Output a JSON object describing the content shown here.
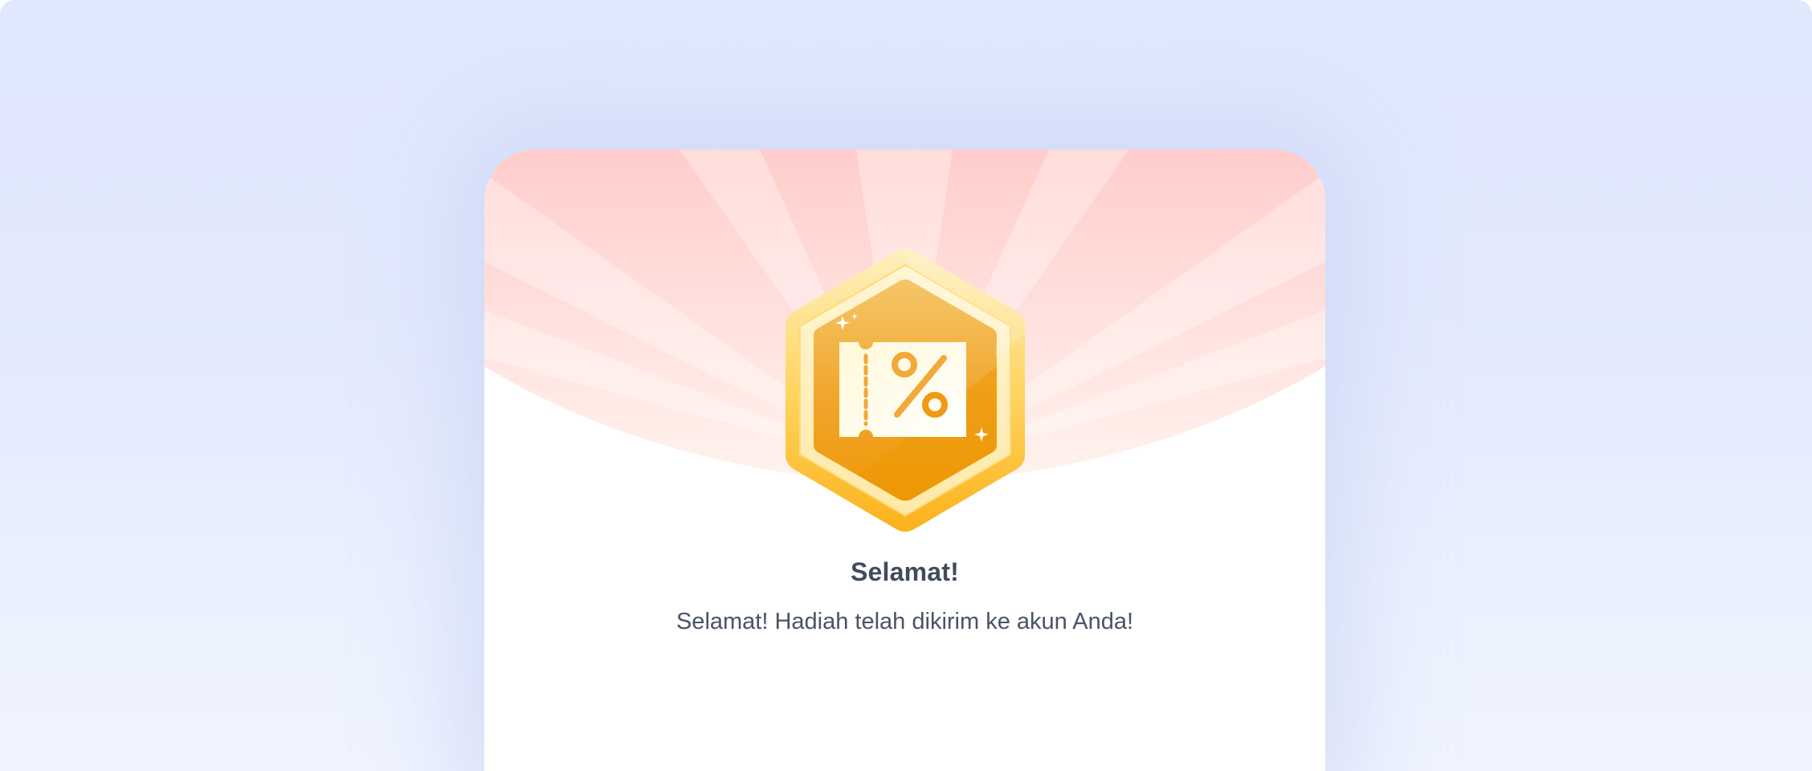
{
  "dialog": {
    "title": "Selamat!",
    "message": "Selamat! Hadiah telah dikirim ke akun Anda!"
  },
  "colors": {
    "page_background": "#e2e9fd",
    "header_gradient_top": "#ffcdcb",
    "header_gradient_bottom": "#fff2ec",
    "badge_gold": "#f6a81d",
    "badge_orange": "#ef9905",
    "text_primary": "#414b5c"
  },
  "icons": {
    "badge": "discount-voucher-badge-icon",
    "voucher": "percent-coupon-icon",
    "sparkle": "sparkle-icon"
  }
}
